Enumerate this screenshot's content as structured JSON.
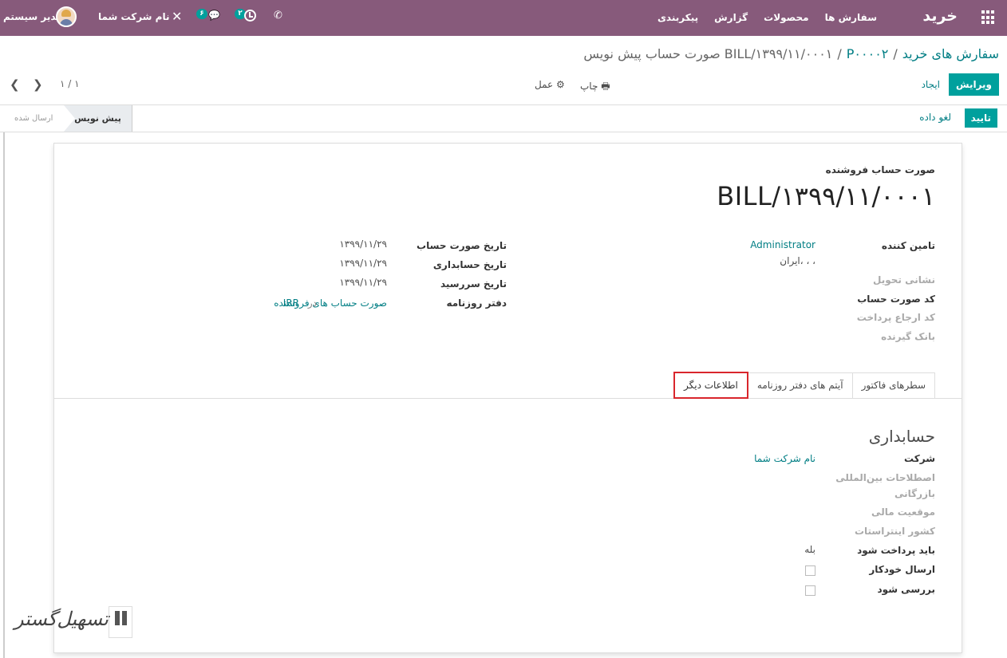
{
  "navbar": {
    "brand": "خرید",
    "menu": [
      "سفارش ها",
      "محصولات",
      "گزارش",
      "پیکربندی"
    ],
    "user_name": "مدیر سیستم",
    "company": "نام شرکت شما",
    "chat_count": "۶",
    "activity_count": "۲"
  },
  "breadcrumb": {
    "root": "سفارش های خرید",
    "order": "P۰۰۰۰۲",
    "current": "صورت حساب پیش نویس BILL/۱۳۹۹/۱۱/۰۰۰۱",
    "separator": "/"
  },
  "toolbar": {
    "edit": "ویرایش",
    "create": "ایجاد",
    "print": "چاپ",
    "action": "عمل",
    "pager": "۱ / ۱"
  },
  "status": {
    "confirm": "تایید",
    "cancel": "لغو داده",
    "stage_draft": "پیش نویس",
    "stage_posted": "ارسال شده"
  },
  "document": {
    "subtitle": "صورت حساب فروشنده",
    "title": "BILL/۱۳۹۹/۱۱/۰۰۰۱"
  },
  "left_fields": {
    "vendor_label": "تامین کننده",
    "vendor_value": "Administrator",
    "vendor_address": "ایران، ، ،",
    "delivery_address_label": "نشانی تحویل",
    "bill_reference_label": "کد صورت حساب",
    "payment_reference_label": "کد ارجاع پرداخت",
    "recipient_bank_label": "بانک گیرنده"
  },
  "right_fields": {
    "bill_date_label": "تاریخ صورت حساب",
    "bill_date_value": "۱۳۹۹/۱۱/۲۹",
    "accounting_date_label": "تاریخ حسابداری",
    "accounting_date_value": "۱۳۹۹/۱۱/۲۹",
    "due_date_label": "تاریخ سررسید",
    "due_date_value": "۱۳۹۹/۱۱/۲۹",
    "journal_label": "دفتر روزنامه",
    "journal_value": "صورت حساب های فروشنده",
    "journal_in": "در",
    "journal_currency": "IRR"
  },
  "tabs": [
    "سطرهای فاکتور",
    "آیتم های دفتر روزنامه",
    "اطلاعات دیگر"
  ],
  "accounting": {
    "title": "حسابداری",
    "company_label": "شرکت",
    "company_value": "نام شرکت شما",
    "incoterm_label_1": "اصطلاحات بین‌المللی",
    "incoterm_label_2": "بازرگانی",
    "fiscal_position_label": "موقعیت مالی",
    "intrastat_country_label": "کشور اینتراستات",
    "to_pay_label": "باید پرداخت شود",
    "to_pay_value": "بله",
    "auto_send_label": "ارسال خودکار",
    "to_check_label": "بررسی شود"
  },
  "watermark": {
    "text": "تسهیل‌گستر"
  }
}
